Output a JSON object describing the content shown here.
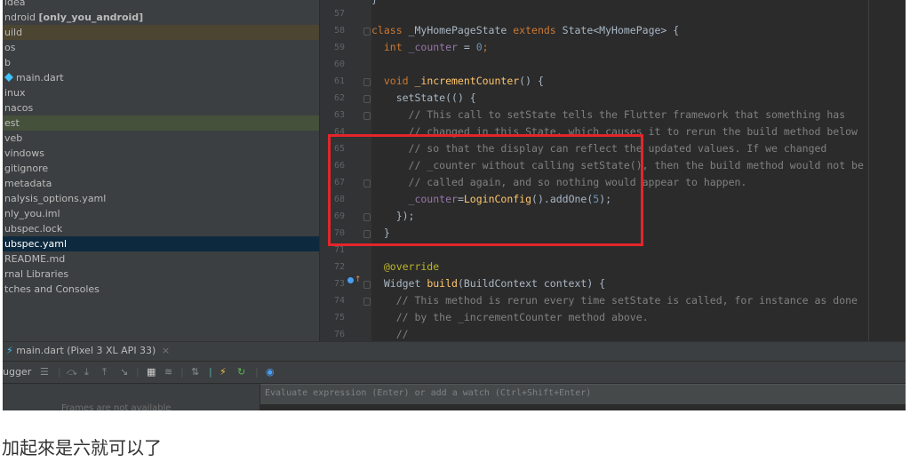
{
  "project_tree": {
    "items": [
      {
        "label": "idea"
      },
      {
        "label": "ndroid",
        "suffix": "[only_you_android]"
      },
      {
        "label": "uild"
      },
      {
        "label": "os"
      },
      {
        "label": "b"
      },
      {
        "label": "main.dart"
      },
      {
        "label": "inux"
      },
      {
        "label": "nacos"
      },
      {
        "label": "est"
      },
      {
        "label": "veb"
      },
      {
        "label": "vindows"
      },
      {
        "label": "gitignore"
      },
      {
        "label": "metadata"
      },
      {
        "label": "nalysis_options.yaml"
      },
      {
        "label": "nly_you.iml"
      },
      {
        "label": "ubspec.lock"
      },
      {
        "label": "ubspec.yaml"
      },
      {
        "label": "README.md"
      },
      {
        "label": "rnal Libraries"
      },
      {
        "label": "tches and Consoles"
      }
    ]
  },
  "editor": {
    "line_numbers": [
      "57",
      "58",
      "59",
      "60",
      "61",
      "62",
      "63",
      "64",
      "65",
      "66",
      "67",
      "68",
      "69",
      "70",
      "71",
      "72",
      "73",
      "74",
      "75",
      "76"
    ],
    "lines": {
      "l58_a": "class ",
      "l58_b": "_MyHomePageState ",
      "l58_c": "extends ",
      "l58_d": "State<MyHomePage> {",
      "l59_a": "  int ",
      "l59_b": "_counter ",
      "l59_c": "= ",
      "l59_d": "0",
      "l59_e": ";",
      "l61_a": "  void ",
      "l61_b": "_incrementCounter",
      "l61_c": "() {",
      "l62_a": "    setState",
      "l62_b": "(() {",
      "l63": "      // This call to setState tells the Flutter framework that something has",
      "l64": "      // changed in this State, which causes it to rerun the build method below",
      "l65": "      // so that the display can reflect the updated values. If we changed",
      "l66": "      // _counter without calling setState(), then the build method would not be",
      "l67": "      // called again, and so nothing would appear to happen.",
      "l68_a": "      _counter",
      "l68_b": "=",
      "l68_c": "LoginConfig",
      "l68_d": "().addOne(",
      "l68_e": "5",
      "l68_f": ");",
      "l69": "    });",
      "l70": "  }",
      "l72": "  @override",
      "l73_a": "  Widget ",
      "l73_b": "build",
      "l73_c": "(BuildContext context) {",
      "l74": "    // This method is rerun every time setState is called, for instance as done",
      "l75": "    // by the _incrementCounter method above.",
      "l76": "    //"
    }
  },
  "run_tab": {
    "title": "main.dart (Pixel 3 XL API 33)",
    "close": "×"
  },
  "debugger": {
    "label": "ugger",
    "eval_placeholder": "Evaluate expression (Enter) or add a watch (Ctrl+Shift+Enter)",
    "frames_text": "Frames are not available"
  },
  "caption": "加起來是六就可以了",
  "colors": {
    "highlight_box": "#e3252b",
    "ide_bg": "#2b2b2b",
    "tree_bg": "#3c3f41"
  }
}
